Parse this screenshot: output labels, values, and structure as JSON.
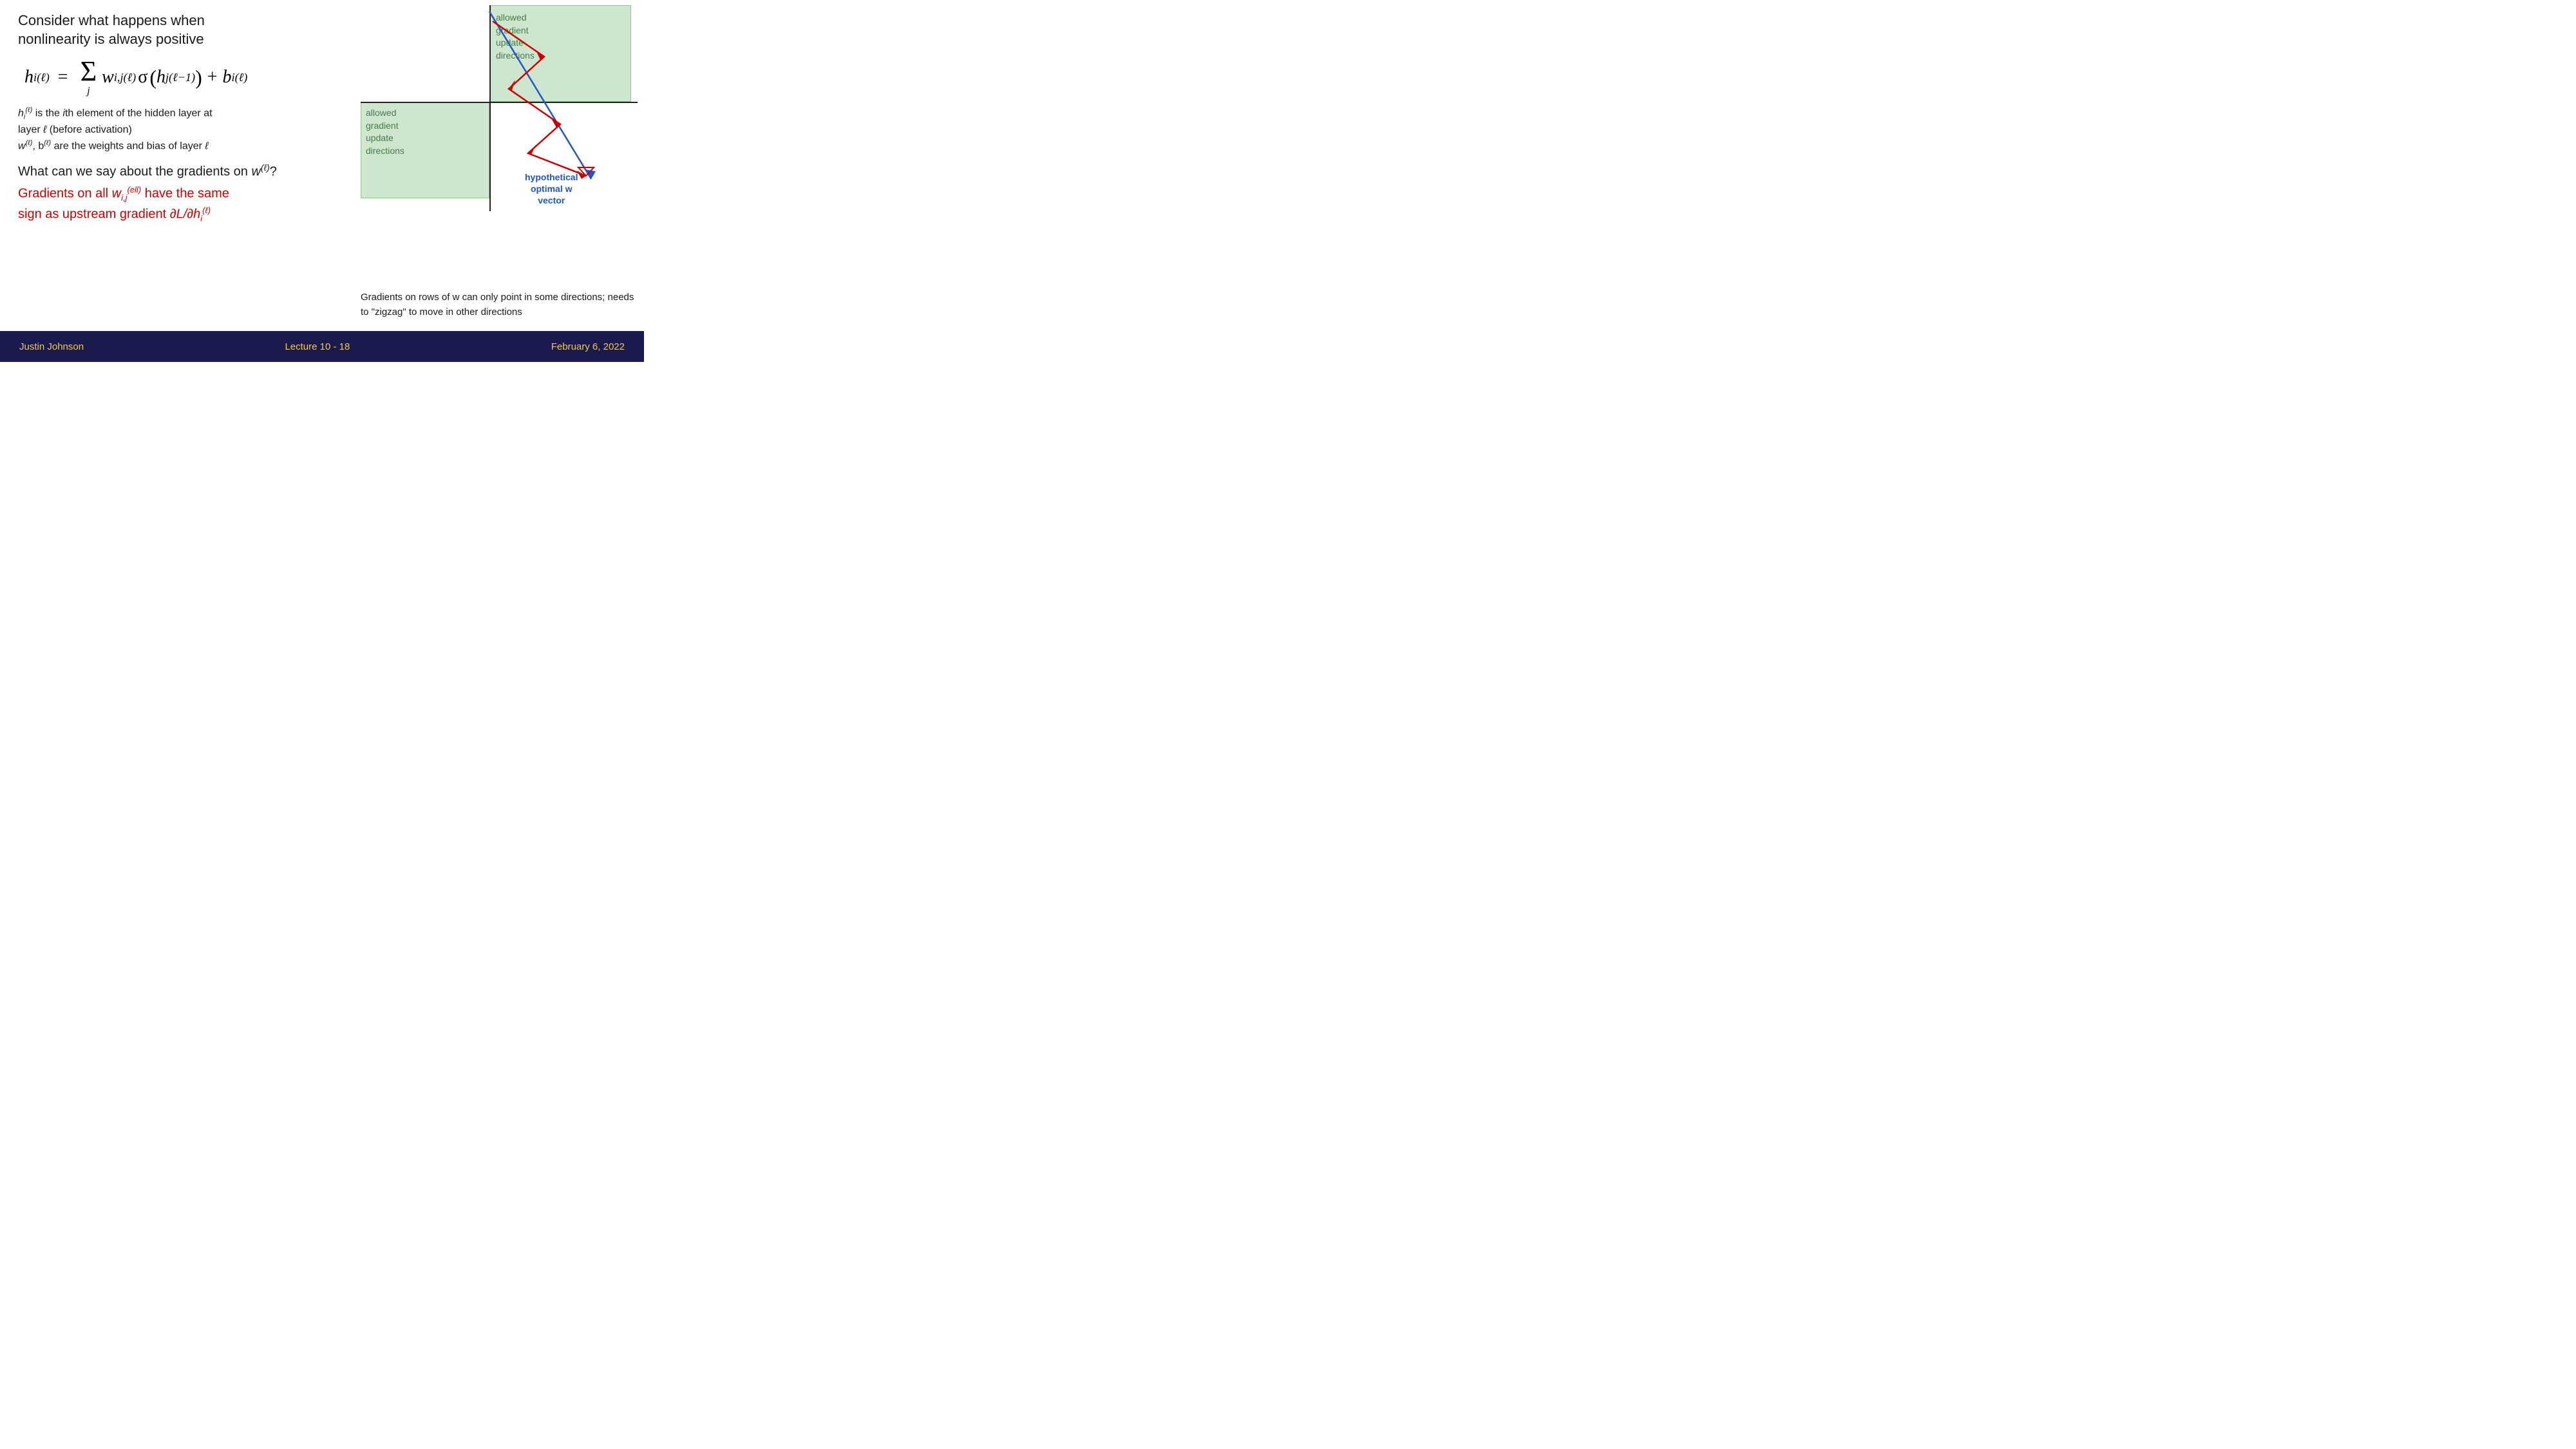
{
  "title": {
    "line1": "Consider what happens when",
    "line2": "nonlinearity is always positive"
  },
  "formula": {
    "display": "h_i^(ℓ) = Σ_j w_{i,j}^(ℓ) σ(h_j^(ℓ-1)) + b_i^(ℓ)"
  },
  "description": {
    "line1": "h_i^(ℓ) is the ith element of the hidden layer at",
    "line2": "layer ℓ (before activation)",
    "line3": "w^(ℓ), b^(ℓ) are the weights and bias of layer ℓ"
  },
  "question": "What can we say about the gradients on w^(ℓ)?",
  "highlight": {
    "line1": "Gradients on all w_{i,j}^(ell) have the same",
    "line2": "sign as upstream gradient ∂L/∂h_i^(ℓ)"
  },
  "diagram": {
    "green_label_top": "allowed\ngradient\nupdate\ndirections",
    "green_label_bottom": "allowed\ngradient\nupdate\ndirections",
    "hypothetical_label": "hypothetical\noptimal w\nvector"
  },
  "bottom_right": {
    "text": "Gradients on rows of w can only point in some directions; needs to \"zigzag\" to move in other directions"
  },
  "footer": {
    "author": "Justin Johnson",
    "lecture": "Lecture 10 - 18",
    "date": "February 6, 2022"
  }
}
